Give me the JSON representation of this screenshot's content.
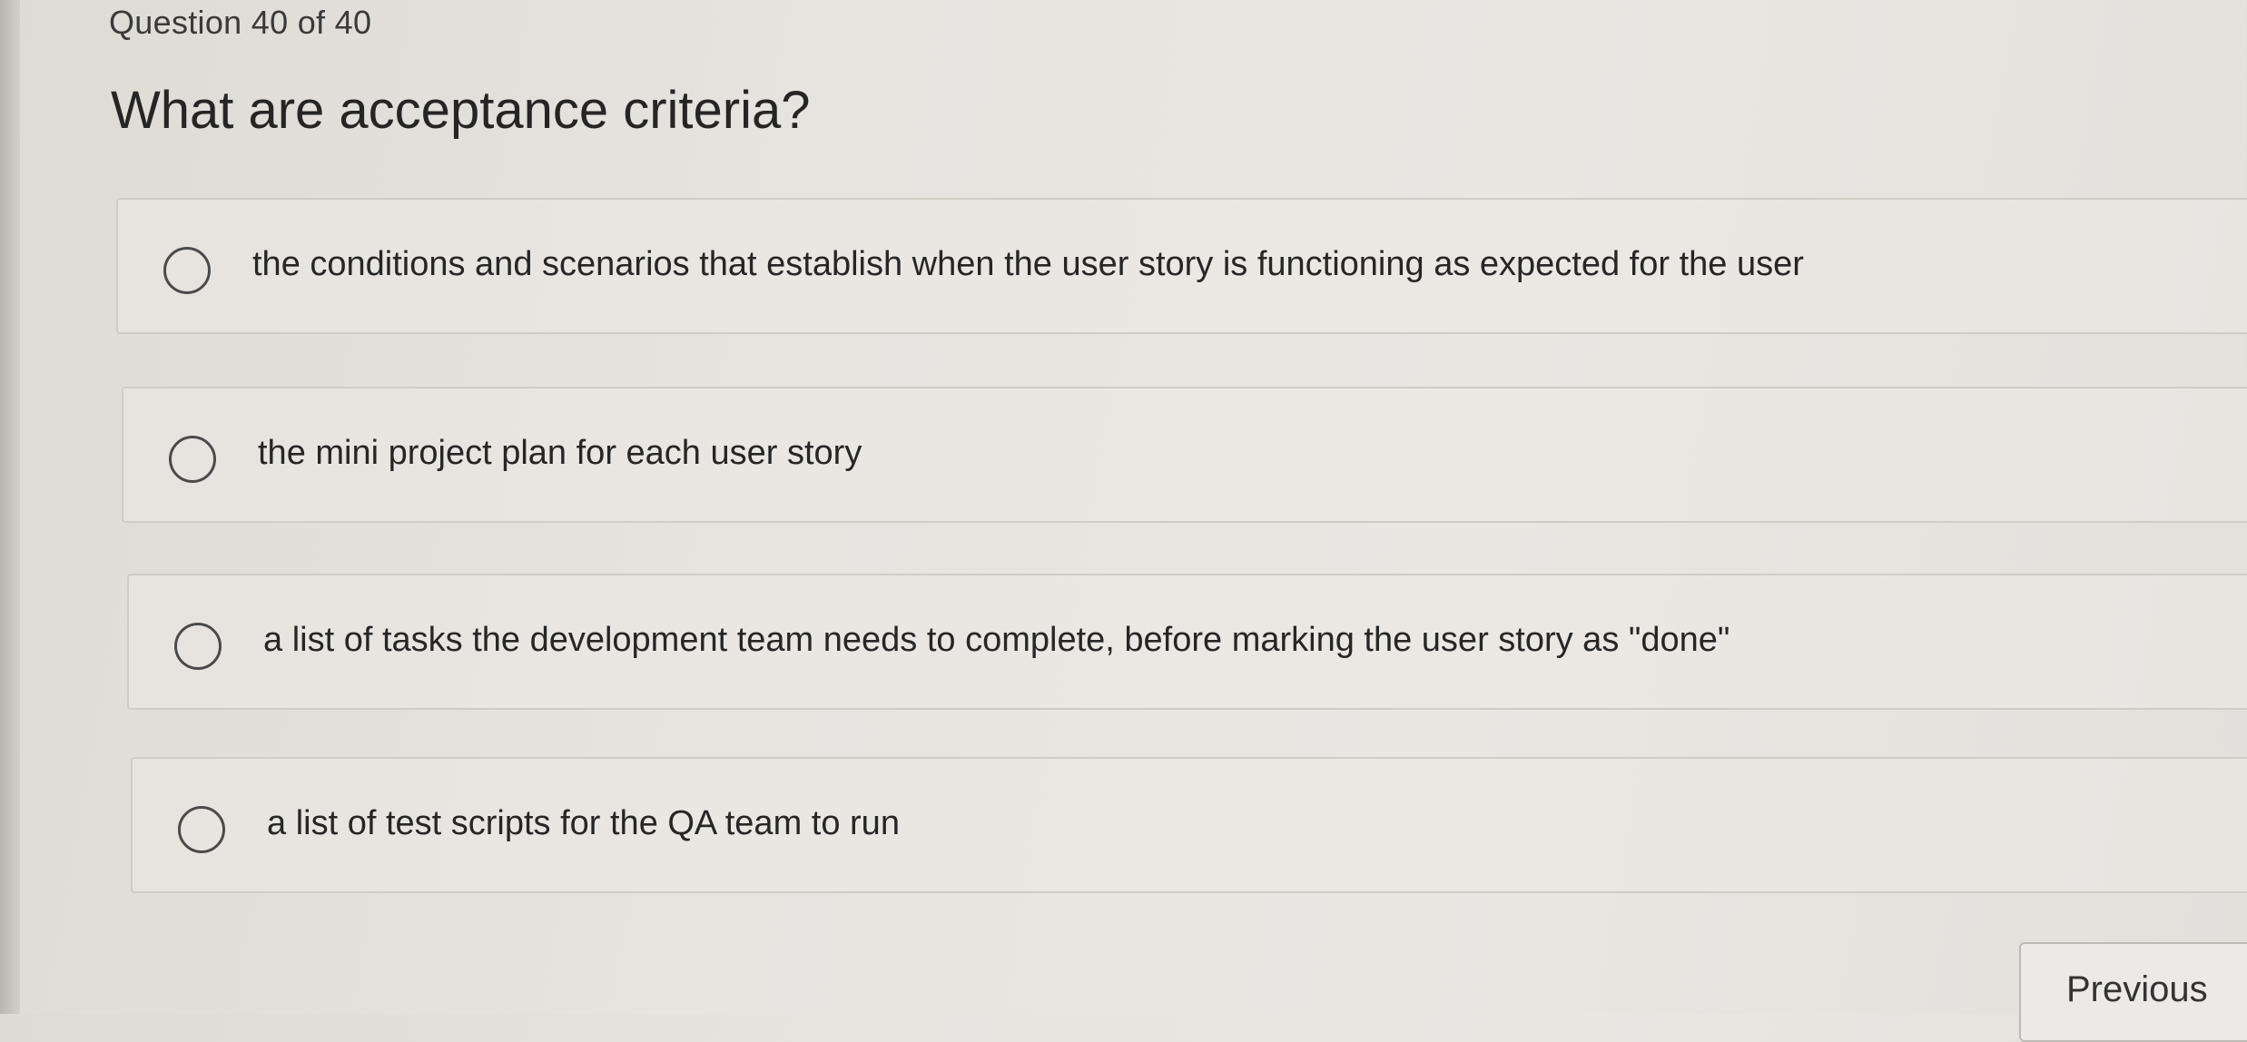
{
  "header": {
    "counter": "Question 40 of 40"
  },
  "question": {
    "text": "What are acceptance criteria?",
    "options": [
      {
        "label": "the conditions and scenarios that establish when the user story is functioning as expected for the user",
        "selected": false
      },
      {
        "label": "the mini project plan for each user story",
        "selected": false
      },
      {
        "label": "a list of tasks the development team needs to complete, before marking the user story as \"done\"",
        "selected": false
      },
      {
        "label": "a list of test scripts for the QA team to run",
        "selected": false
      }
    ]
  },
  "navigation": {
    "previous_label": "Previous"
  }
}
